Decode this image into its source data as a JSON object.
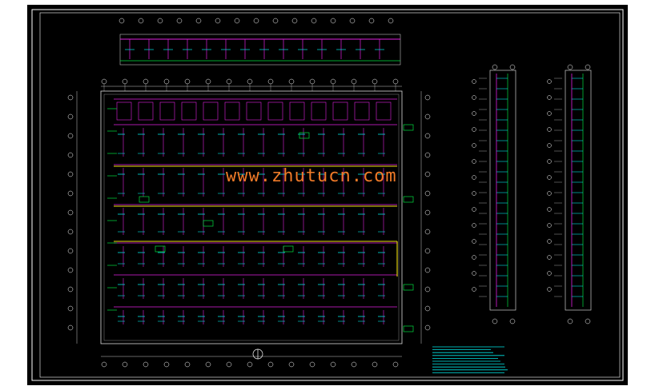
{
  "watermark": "www.zhutucn.com",
  "colors": {
    "background": "#000000",
    "frame": "#ffffff",
    "pipe_main": "#e020e0",
    "pipe_branch": "#00e5e5",
    "pipe_yellow": "#f0e010",
    "pipe_green": "#00e040",
    "wall": "#ffffff",
    "watermark": "#f07a28"
  },
  "icons": [
    "north-arrow-icon"
  ]
}
